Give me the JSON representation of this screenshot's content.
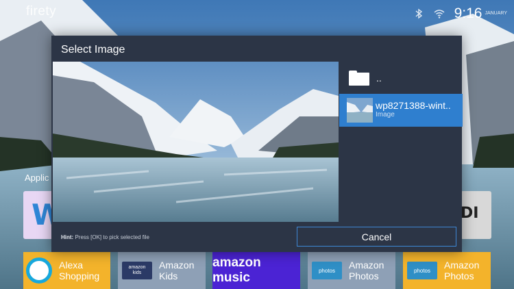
{
  "app": {
    "logo_text": "firety"
  },
  "status_bar": {
    "time": "9:16",
    "date": "JANUARY"
  },
  "home": {
    "row_label": "Applic",
    "left_tile_text": "W",
    "right_tile_text": "DI",
    "bottom_tiles": [
      {
        "line1": "Alexa",
        "line2": "Shopping"
      },
      {
        "line1": "Amazon",
        "line2": "Kids",
        "badge_top": "amazon",
        "badge_bottom": "kids"
      },
      {
        "logo": "amazon music"
      },
      {
        "line1": "Amazon",
        "line2": "Photos",
        "badge": "photos"
      },
      {
        "line1": "Amazon",
        "line2": "Photos",
        "badge": "photos"
      }
    ]
  },
  "dialog": {
    "title": "Select Image",
    "parent_dir_label": "..",
    "selected_file": {
      "name": "wp8271388-wint..",
      "type": "Image"
    },
    "hint_label": "Hint:",
    "hint_text": "Press [OK] to pick selected file",
    "cancel_label": "Cancel"
  },
  "colors": {
    "dialog_bg": "#2c3546",
    "selection": "#2f7fcf",
    "button_border": "#3e88d6",
    "alexa": "#f3b32b",
    "music": "#4b23d4"
  }
}
